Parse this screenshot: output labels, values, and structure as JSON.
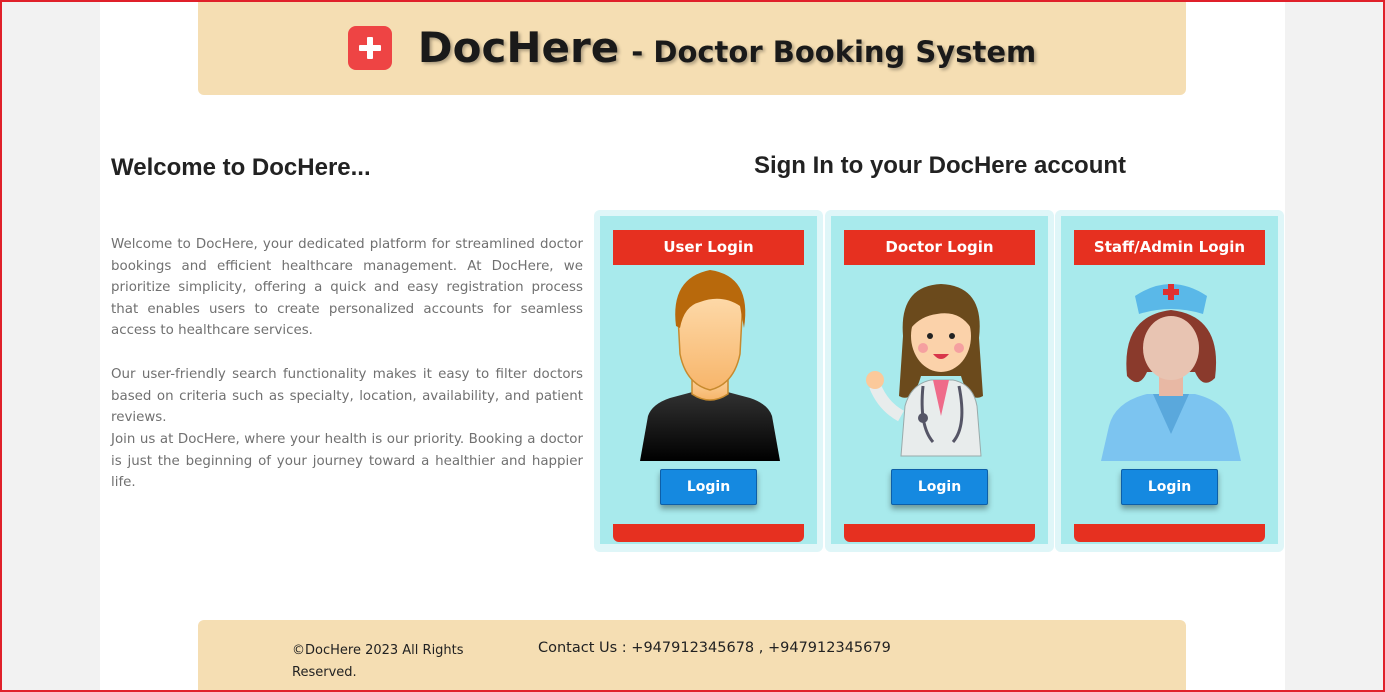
{
  "header": {
    "brand": "DocHere",
    "subtitle": "- Doctor Booking System",
    "icon": "medical-cross-icon"
  },
  "welcome": {
    "title": "Welcome to DocHere...",
    "paragraphs": [
      "Welcome to DocHere, your dedicated platform for streamlined doctor bookings and efficient healthcare management. At DocHere, we prioritize simplicity, offering a quick and easy registration process that enables users to create personalized accounts for seamless access to healthcare services.",
      "Our user-friendly search functionality makes it easy to filter doctors based on criteria such as specialty, location, availability, and patient reviews.",
      "Join us at DocHere, where your health is our priority. Booking a doctor is just the beginning of your journey toward a healthier and happier life."
    ]
  },
  "signin": {
    "title": "Sign In to your DocHere account",
    "cards": [
      {
        "title": "User Login",
        "button": "Login",
        "avatar": "user-avatar-icon"
      },
      {
        "title": "Doctor Login",
        "button": "Login",
        "avatar": "doctor-avatar-icon"
      },
      {
        "title": "Staff/Admin Login",
        "button": "Login",
        "avatar": "nurse-avatar-icon"
      }
    ]
  },
  "footer": {
    "copyright": "©DocHere 2023 All Rights Reserved.",
    "contact": "Contact Us : +947912345678 , +947912345679"
  },
  "colors": {
    "header_bg": "#f5deb3",
    "card_bg": "#a8eaec",
    "card_accent": "#e63020",
    "button": "#1589e0"
  }
}
